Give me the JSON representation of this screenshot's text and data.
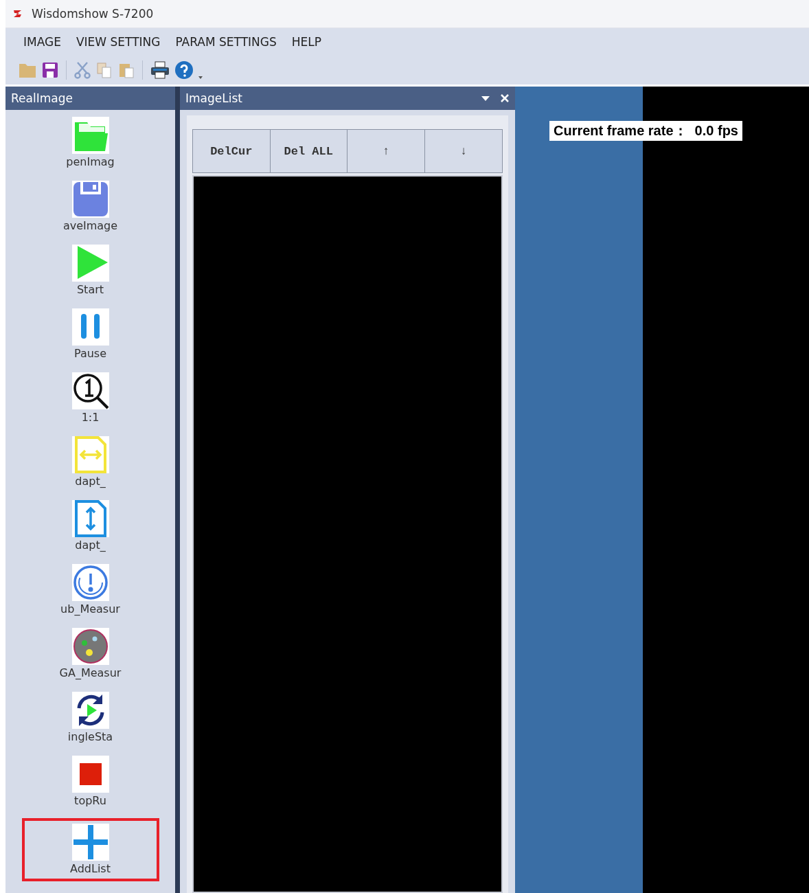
{
  "window": {
    "title": "Wisdomshow S-7200"
  },
  "menu": [
    "IMAGE",
    "VIEW SETTING",
    "PARAM SETTINGS",
    "HELP"
  ],
  "left_panel": {
    "title": "RealImage",
    "items": [
      {
        "kind": "folder",
        "label": "penImag",
        "highlighted": false
      },
      {
        "kind": "save",
        "label": "aveImage",
        "highlighted": false
      },
      {
        "kind": "play",
        "label": "Start",
        "highlighted": false
      },
      {
        "kind": "pause",
        "label": "Pause",
        "highlighted": false
      },
      {
        "kind": "zoom",
        "label": "1:1",
        "highlighted": false
      },
      {
        "kind": "width",
        "label": "dapt_",
        "highlighted": false
      },
      {
        "kind": "height",
        "label": "dapt_",
        "highlighted": false
      },
      {
        "kind": "gauge",
        "label": "ub_Measur",
        "highlighted": false
      },
      {
        "kind": "ball",
        "label": "GA_Measur",
        "highlighted": false
      },
      {
        "kind": "refresh",
        "label": "ingleSta",
        "highlighted": false
      },
      {
        "kind": "stop",
        "label": "topRu",
        "highlighted": false
      },
      {
        "kind": "plus",
        "label": "AddList",
        "highlighted": true
      }
    ]
  },
  "image_list": {
    "title": "ImageList",
    "buttons": [
      "DelCur",
      "Del ALL",
      "↑",
      "↓"
    ]
  },
  "viewer": {
    "frame_rate": "Current frame rate：  0.0 fps"
  }
}
